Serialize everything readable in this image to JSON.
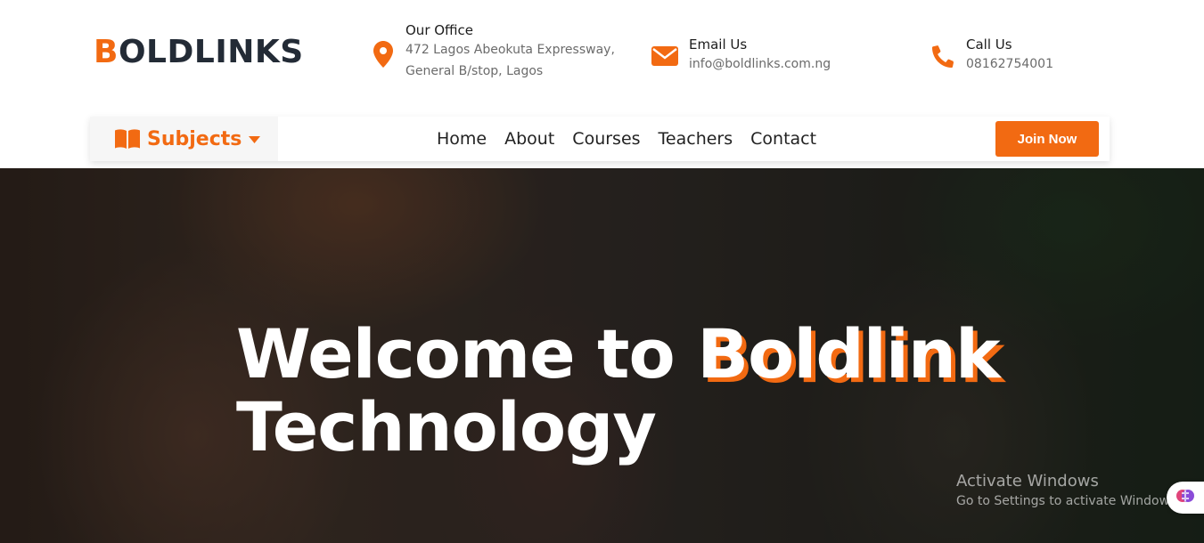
{
  "brand": {
    "first_letter": "B",
    "rest": "OLDLINKS"
  },
  "contact": {
    "office": {
      "title": "Our Office",
      "line1": "472 Lagos Abeokuta Expressway,",
      "line2": "General B/stop, Lagos",
      "icon": "map-marker-icon"
    },
    "email": {
      "title": "Email Us",
      "value": "info@boldlinks.com.ng",
      "icon": "envelope-icon"
    },
    "call": {
      "title": "Call Us",
      "value": "08162754001",
      "icon": "phone-icon"
    }
  },
  "nav": {
    "subjects_label": "Subjects",
    "items": [
      "Home",
      "About",
      "Courses",
      "Teachers",
      "Contact"
    ],
    "join_label": "Join Now"
  },
  "hero": {
    "title_part1": "Welcome to ",
    "title_highlight": "Boldlink",
    "title_line2": "Technology"
  },
  "watermark": {
    "line1": "Activate Windows",
    "line2": "Go to Settings to activate Windows."
  },
  "colors": {
    "accent": "#f26a12",
    "dark": "#232b36"
  }
}
